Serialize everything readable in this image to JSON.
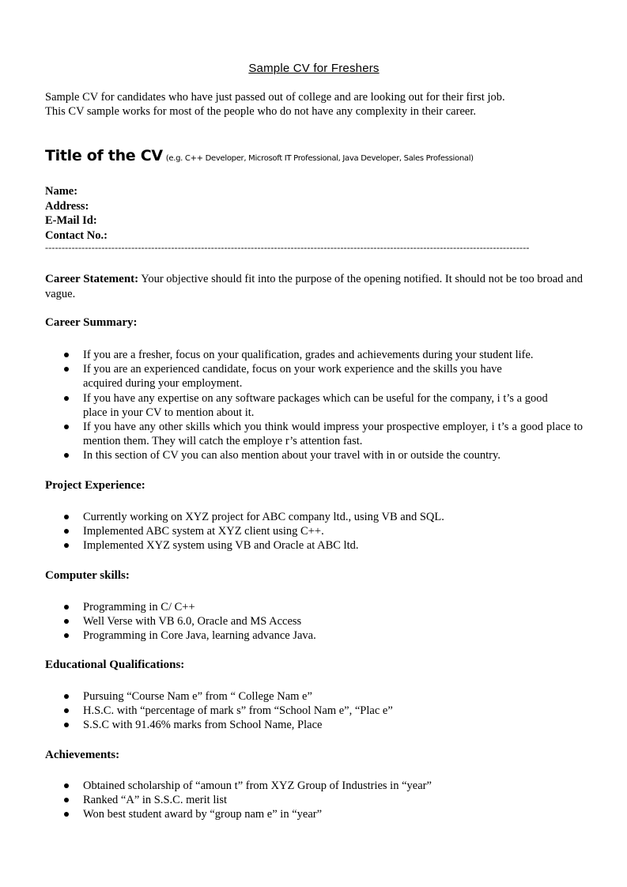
{
  "document": {
    "title": "Sample CV for Freshers",
    "intro": [
      "Sample CV for candidates who have just passed out of college and are looking out for their first job.",
      "This CV sample works for most of the people who do not have any complexity in their career."
    ],
    "cv_title": {
      "heading": "Title of the CV",
      "example": "(e.g. C++ Developer, Microsoft IT Professional, Java Developer, Sales Professional)"
    },
    "contact_fields": [
      "Name:",
      "Address:",
      "E-Mail Id:",
      "Contact No.:"
    ],
    "divider": "--------------------------------------------------------------------------------------------------------------------------------------------------",
    "career_statement": {
      "label": "Career Statement:",
      "text": "Your objective should fit into the purpose of the opening notified.  It should not be too broad and vague."
    },
    "sections": [
      {
        "heading": "Career Summary:",
        "items": [
          "If you are a fresher, focus on your qualification, grades and achievements during your student life.",
          "If you are an experienced candidate, focus on your work experience and the skills you have acquired during your employment.",
          "If you have any expertise on any software packages which can be useful for the company, i    t’s a good place in your CV to mention about it.",
          "If you have any other skills which you think would impress your prospective employer, i    t’s a good place to mention them. They will catch the employe    r’s attention fast.",
          "In this section of CV you can also mention about your travel with in or outside the country."
        ]
      },
      {
        "heading": "Project Experience:",
        "items": [
          "Currently working on XYZ project for ABC company ltd., using VB and SQL.",
          "Implemented ABC system at XYZ client using C++.",
          "Implemented XYZ system using VB and Oracle at ABC ltd."
        ]
      },
      {
        "heading": "Computer skills:",
        "items": [
          "Programming in C/ C++",
          "Well Verse with VB 6.0, Oracle and MS Access",
          "Programming in Core Java, learning advance Java."
        ]
      },
      {
        "heading": "Educational Qualifications:",
        "items": [
          "Pursuing  “Course Nam e” from “ College Nam e”",
          "H.S.C. with “percentage of mark  s” from “School Nam e”, “Plac e”",
          "S.S.C with 91.46% marks from School Name, Place"
        ]
      },
      {
        "heading": "Achievements:",
        "items": [
          "Obtained scholarship of   “amoun t” from XYZ Group of Industries in    “year”",
          "Ranked “A” in S.S.C. merit list",
          "Won best student award by  “group nam e” in “year”"
        ]
      }
    ]
  }
}
